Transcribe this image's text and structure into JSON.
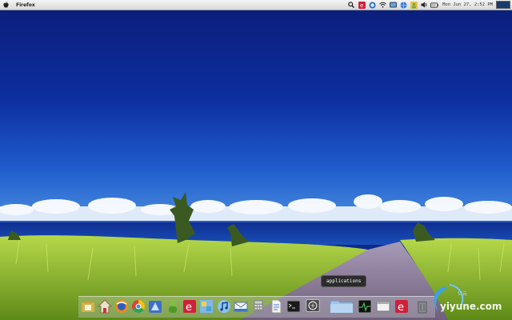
{
  "menubar": {
    "app_name": "Firefox",
    "clock": "Mon Jun 27,  2:52 PM",
    "tray_icons": [
      "search-icon",
      "app-e-icon",
      "app-circle-icon",
      "wifi-icon",
      "network-icon",
      "globe-icon",
      "user-icon",
      "volume-icon",
      "battery-icon"
    ]
  },
  "dock": {
    "tooltip": "applications",
    "items": [
      "files-icon",
      "home-icon",
      "browser-icon",
      "chrome-icon",
      "app-blue-icon",
      "green-app-icon",
      "red-e-icon",
      "photos-icon",
      "music-icon",
      "mail-icon",
      "calculator-icon",
      "document-icon",
      "terminal-icon",
      "applications-icon",
      "folder-icon",
      "activity-monitor-icon",
      "window-icon",
      "red-app-icon",
      "trash-icon"
    ]
  },
  "watermark": {
    "text": "yiyune.com",
    "small": "亿云"
  },
  "colors": {
    "sky_top": "#0a1f7a",
    "sky_bottom": "#2a6fd0",
    "ocean": "#123a9a",
    "grass": "#8fbf2a",
    "path": "#8b7fa0"
  }
}
